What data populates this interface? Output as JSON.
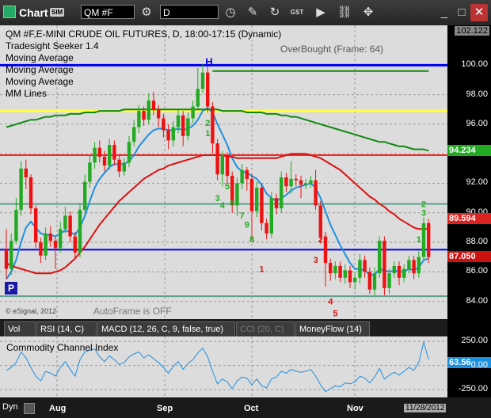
{
  "toolbar": {
    "app_label": "Chart",
    "sim_label": "SIM",
    "symbol": "QM #F",
    "interval": "D",
    "gst_label": "GST"
  },
  "window_controls": {
    "minimize": "_",
    "maximize": "□",
    "close": "✕"
  },
  "chart_header": {
    "line1": "QM #F,E-MINI CRUDE OIL FUTURES, D, 18:00-17:15 (Dynamic)",
    "line2": "Tradesight Seeker 1.4",
    "line3": "Moving Average",
    "line4": "Moving Average",
    "line5": "Moving Average",
    "line6": "MM Lines",
    "overbought": "OverBought (Frame: 64)",
    "copyright": "© eSignal, 2012",
    "autoframe": "AutoFrame is OFF",
    "p_button": "P"
  },
  "cci_panel": {
    "title": "Commodity Channel Index",
    "value_badge": "63.56"
  },
  "tabs": [
    {
      "label": "Vol",
      "active": false
    },
    {
      "label": "RSI (14, C)",
      "active": false
    },
    {
      "label": "MACD (12, 26, C, 9, false, true)",
      "active": false
    },
    {
      "label": "CCI (20, C)",
      "active": true
    },
    {
      "label": "MoneyFlow (14)",
      "active": false
    }
  ],
  "footer": {
    "dyn_label": "Dyn",
    "date_badge": "11/28/2012"
  },
  "colors": {
    "plot_bg": "#dcdcdc",
    "up": "#22aa22",
    "down": "#ee1111",
    "ma_blue": "#1e90e0",
    "ma_red": "#dd1111",
    "ma_green": "#118811",
    "line_blue": "#0000ee",
    "line_yellow": "#ffff44",
    "line_red": "#ff2222",
    "line_teal": "#5f9f8f",
    "badge_price": "#cc1111",
    "badge_green": "#22aa22",
    "badge_red": "#dd2222",
    "badge_blue": "#1e90e0"
  },
  "chart_data": {
    "type": "candlestick",
    "x_ticks": [
      "Aug",
      "Sep",
      "Oct",
      "Nov"
    ],
    "y_ticks": [
      84.0,
      86.0,
      88.0,
      90.0,
      92.0,
      94.0,
      96.0,
      98.0,
      100.0,
      102.122
    ],
    "ylim": [
      82.8,
      102.7
    ],
    "value_badges": [
      {
        "value": "94.234",
        "color": "#22aa22",
        "y": 94.234
      },
      {
        "value": "89.594",
        "color": "#dd2222",
        "y": 89.594
      },
      {
        "value": "87.050",
        "color": "#cc1111",
        "y": 87.05
      }
    ],
    "horizontal_lines": [
      {
        "y": 100.0,
        "color": "#0000ee",
        "width": 3
      },
      {
        "y": 96.9,
        "color": "#ffff44",
        "width": 3
      },
      {
        "y": 93.9,
        "color": "#ff2222",
        "width": 2
      },
      {
        "y": 90.6,
        "color": "#5f9f8f",
        "width": 2
      },
      {
        "y": 87.5,
        "color": "#0000ee",
        "width": 2
      },
      {
        "y": 84.35,
        "color": "#5f9f8f",
        "width": 2
      }
    ],
    "candles": [
      [
        87.5,
        86.2,
        88.9,
        85.5
      ],
      [
        86.2,
        88.1,
        88.6,
        85.8
      ],
      [
        88.1,
        90.2,
        91.0,
        87.9
      ],
      [
        90.2,
        93.0,
        93.5,
        89.8
      ],
      [
        93.0,
        92.4,
        93.6,
        91.6
      ],
      [
        92.4,
        90.3,
        92.6,
        89.9
      ],
      [
        90.3,
        88.0,
        90.5,
        87.6
      ],
      [
        88.0,
        87.1,
        88.3,
        86.6
      ],
      [
        87.1,
        88.6,
        89.0,
        86.8
      ],
      [
        88.6,
        88.1,
        89.1,
        87.7
      ],
      [
        88.1,
        87.6,
        88.4,
        86.2
      ],
      [
        87.6,
        88.9,
        89.4,
        87.3
      ],
      [
        88.9,
        89.8,
        90.4,
        88.6
      ],
      [
        89.8,
        88.4,
        90.1,
        88.0
      ],
      [
        88.4,
        87.3,
        88.7,
        86.9
      ],
      [
        87.3,
        90.2,
        90.6,
        87.0
      ],
      [
        90.2,
        92.1,
        92.6,
        89.9
      ],
      [
        92.1,
        93.4,
        93.9,
        91.7
      ],
      [
        93.4,
        94.4,
        94.8,
        93.0
      ],
      [
        94.4,
        93.8,
        94.9,
        93.4
      ],
      [
        93.8,
        93.2,
        94.2,
        92.8
      ],
      [
        93.2,
        94.6,
        95.0,
        92.9
      ],
      [
        94.6,
        93.6,
        94.9,
        93.2
      ],
      [
        93.6,
        92.8,
        93.9,
        92.4
      ],
      [
        92.8,
        93.4,
        93.7,
        92.5
      ],
      [
        93.4,
        94.8,
        95.2,
        93.1
      ],
      [
        94.8,
        95.8,
        96.3,
        94.5
      ],
      [
        95.8,
        96.9,
        97.3,
        95.4
      ],
      [
        96.9,
        96.3,
        97.2,
        95.9
      ],
      [
        96.3,
        97.6,
        98.1,
        96.0
      ],
      [
        97.6,
        97.0,
        98.2,
        96.6
      ],
      [
        97.0,
        96.4,
        97.3,
        95.8
      ],
      [
        96.4,
        95.6,
        96.7,
        95.1
      ],
      [
        95.6,
        94.9,
        96.0,
        94.3
      ],
      [
        94.9,
        95.8,
        96.2,
        94.5
      ],
      [
        95.8,
        96.6,
        97.0,
        95.4
      ],
      [
        96.6,
        95.2,
        96.9,
        94.5
      ],
      [
        95.2,
        96.4,
        96.8,
        94.9
      ],
      [
        96.4,
        97.2,
        97.6,
        96.1
      ],
      [
        97.2,
        98.4,
        99.8,
        97.0
      ],
      [
        98.4,
        99.5,
        100.1,
        98.1
      ],
      [
        99.5,
        97.2,
        99.9,
        96.8
      ],
      [
        97.2,
        94.7,
        97.5,
        94.0
      ],
      [
        94.7,
        92.6,
        95.0,
        92.2
      ],
      [
        92.6,
        93.9,
        94.2,
        91.8
      ],
      [
        93.9,
        92.5,
        94.1,
        92.0
      ],
      [
        92.5,
        90.5,
        92.8,
        90.0
      ],
      [
        90.5,
        92.0,
        92.4,
        89.8
      ],
      [
        92.0,
        92.9,
        93.3,
        91.6
      ],
      [
        92.9,
        92.3,
        93.1,
        91.5
      ],
      [
        92.3,
        90.1,
        92.6,
        88.2
      ],
      [
        90.1,
        91.7,
        92.1,
        89.7
      ],
      [
        91.7,
        89.3,
        92.0,
        88.8
      ],
      [
        89.3,
        88.6,
        89.6,
        88.2
      ],
      [
        88.6,
        91.0,
        91.4,
        88.3
      ],
      [
        91.0,
        90.3,
        91.3,
        89.9
      ],
      [
        90.3,
        92.4,
        92.8,
        90.0
      ],
      [
        92.4,
        91.8,
        92.7,
        91.4
      ],
      [
        91.8,
        92.3,
        93.5,
        91.3
      ],
      [
        92.3,
        92.2,
        92.6,
        91.8
      ],
      [
        92.2,
        91.9,
        92.5,
        91.0
      ],
      [
        91.9,
        92.0,
        92.3,
        91.6
      ],
      [
        92.0,
        92.2,
        92.5,
        91.7
      ],
      [
        92.2,
        90.5,
        92.9,
        90.2
      ],
      [
        90.5,
        88.4,
        90.8,
        87.9
      ],
      [
        88.4,
        86.6,
        88.7,
        85.0
      ],
      [
        86.6,
        85.9,
        86.9,
        85.4
      ],
      [
        85.9,
        86.4,
        86.7,
        85.5
      ],
      [
        86.4,
        85.6,
        86.7,
        85.3
      ],
      [
        85.6,
        86.1,
        86.5,
        85.2
      ],
      [
        86.1,
        85.3,
        86.4,
        84.9
      ],
      [
        85.3,
        85.6,
        86.0,
        84.8
      ],
      [
        85.6,
        86.8,
        87.2,
        85.2
      ],
      [
        86.8,
        86.0,
        87.1,
        85.6
      ],
      [
        86.0,
        84.8,
        86.3,
        84.5
      ],
      [
        84.8,
        85.9,
        86.3,
        84.4
      ],
      [
        85.9,
        88.1,
        88.4,
        85.6
      ],
      [
        88.1,
        84.9,
        88.4,
        84.4
      ],
      [
        84.9,
        85.9,
        86.2,
        84.5
      ],
      [
        85.9,
        86.4,
        86.7,
        85.6
      ],
      [
        86.4,
        85.6,
        86.7,
        85.1
      ],
      [
        85.6,
        86.2,
        86.5,
        85.3
      ],
      [
        86.2,
        86.8,
        87.1,
        85.9
      ],
      [
        86.8,
        85.9,
        87.1,
        85.5
      ],
      [
        85.9,
        87.0,
        87.4,
        85.6
      ],
      [
        87.0,
        89.3,
        89.7,
        86.8
      ],
      [
        89.3,
        87.0,
        89.6,
        86.6
      ]
    ],
    "moving_averages": [
      {
        "name": "",
        "color": "#1e90e0",
        "values": [
          85.5,
          86.0,
          86.8,
          88.0,
          89.0,
          89.4,
          89.0,
          88.6,
          88.5,
          88.5,
          88.4,
          88.6,
          88.8,
          88.7,
          88.5,
          89.0,
          89.8,
          90.8,
          91.7,
          92.3,
          92.7,
          93.1,
          93.3,
          93.3,
          93.3,
          93.5,
          93.9,
          94.5,
          94.9,
          95.3,
          95.6,
          95.7,
          95.7,
          95.6,
          95.6,
          95.7,
          95.6,
          95.7,
          95.9,
          96.3,
          96.9,
          97.1,
          96.8,
          96.0,
          95.3,
          94.6,
          93.7,
          93.1,
          92.8,
          92.7,
          92.5,
          92.3,
          91.9,
          91.3,
          91.0,
          90.8,
          91.0,
          91.2,
          91.5,
          91.7,
          91.8,
          91.9,
          92.0,
          91.7,
          91.0,
          90.1,
          89.2,
          88.5,
          87.8,
          87.2,
          86.6,
          86.2,
          86.2,
          86.1,
          85.8,
          85.8,
          86.2,
          86.1,
          86.0,
          86.1,
          86.0,
          86.0,
          86.2,
          86.1,
          86.3,
          86.8,
          86.9
        ]
      },
      {
        "name": "",
        "color": "#dd1111",
        "values": [
          86.6,
          86.4,
          86.3,
          86.2,
          86.1,
          86.0,
          85.9,
          85.9,
          85.9,
          85.9,
          86.0,
          86.1,
          86.3,
          86.6,
          86.9,
          87.3,
          87.7,
          88.2,
          88.7,
          89.2,
          89.6,
          90.0,
          90.4,
          90.8,
          91.1,
          91.4,
          91.7,
          92.0,
          92.3,
          92.5,
          92.7,
          92.9,
          93.0,
          93.2,
          93.3,
          93.4,
          93.5,
          93.6,
          93.7,
          93.8,
          93.9,
          93.9,
          93.9,
          93.9,
          93.9,
          93.8,
          93.8,
          93.7,
          93.7,
          93.7,
          93.7,
          93.7,
          93.7,
          93.7,
          93.7,
          93.7,
          93.8,
          93.9,
          94.0,
          94.0,
          94.0,
          94.0,
          93.9,
          93.8,
          93.7,
          93.5,
          93.3,
          93.1,
          92.9,
          92.6,
          92.3,
          92.0,
          91.7,
          91.4,
          91.1,
          90.9,
          90.6,
          90.4,
          90.1,
          89.9,
          89.6,
          89.4,
          89.2,
          89.0,
          88.9,
          88.9,
          88.9
        ]
      },
      {
        "name": "",
        "color": "#118811",
        "values": [
          95.8,
          95.9,
          96.0,
          96.1,
          96.2,
          96.3,
          96.3,
          96.4,
          96.5,
          96.5,
          96.6,
          96.6,
          96.6,
          96.7,
          96.7,
          96.7,
          96.8,
          96.8,
          96.8,
          96.9,
          96.9,
          96.9,
          96.9,
          96.9,
          97.0,
          97.0,
          97.0,
          97.0,
          97.0,
          97.0,
          97.0,
          97.0,
          97.0,
          97.0,
          97.0,
          97.0,
          97.0,
          97.0,
          97.0,
          97.0,
          97.0,
          97.0,
          97.0,
          97.0,
          96.9,
          96.9,
          96.9,
          96.9,
          96.9,
          96.8,
          96.8,
          96.8,
          96.8,
          96.7,
          96.7,
          96.7,
          96.6,
          96.6,
          96.5,
          96.5,
          96.4,
          96.3,
          96.2,
          96.1,
          96.0,
          95.9,
          95.8,
          95.7,
          95.6,
          95.5,
          95.4,
          95.3,
          95.2,
          95.1,
          95.0,
          94.9,
          94.8,
          94.8,
          94.7,
          94.6,
          94.5,
          94.5,
          94.4,
          94.3,
          94.3,
          94.3,
          94.2
        ]
      }
    ],
    "counts": [
      {
        "i": 41,
        "y": 95.2,
        "text": "1",
        "color": "#22aa22"
      },
      {
        "i": 41,
        "y": 95.9,
        "text": "2",
        "color": "#22aa22"
      },
      {
        "i": 41,
        "y": 100.0,
        "text": "H",
        "color": "#0000ee"
      },
      {
        "i": 43,
        "y": 90.8,
        "text": "3",
        "color": "#22aa22"
      },
      {
        "i": 44,
        "y": 90.3,
        "text": "4",
        "color": "#22aa22"
      },
      {
        "i": 45,
        "y": 91.6,
        "text": "5",
        "color": "#22aa22"
      },
      {
        "i": 46,
        "y": 90.5,
        "text": "6",
        "color": "#22aa22"
      },
      {
        "i": 48,
        "y": 89.6,
        "text": "7",
        "color": "#22aa22"
      },
      {
        "i": 50,
        "y": 88.0,
        "text": "8",
        "color": "#22aa22"
      },
      {
        "i": 49,
        "y": 89.0,
        "text": "9",
        "color": "#22aa22"
      },
      {
        "i": 52,
        "y": 86.0,
        "text": "1",
        "color": "#dd1111"
      },
      {
        "i": 64,
        "y": 88.0,
        "text": "2",
        "color": "#dd1111"
      },
      {
        "i": 63,
        "y": 86.6,
        "text": "3",
        "color": "#dd1111"
      },
      {
        "i": 66,
        "y": 83.8,
        "text": "4",
        "color": "#dd1111"
      },
      {
        "i": 67,
        "y": 83.0,
        "text": "5",
        "color": "#dd1111"
      },
      {
        "i": 84,
        "y": 88.0,
        "text": "1",
        "color": "#22aa22"
      },
      {
        "i": 85,
        "y": 90.4,
        "text": "2",
        "color": "#22aa22"
      },
      {
        "i": 85,
        "y": 89.8,
        "text": "3",
        "color": "#22aa22"
      }
    ],
    "overbought_line": {
      "from": 42,
      "to": 86,
      "y": 99.6,
      "color": "#118811"
    },
    "cci": {
      "y_ticks": [
        250.0,
        0.0,
        -250.0
      ],
      "ylim": [
        -330,
        300
      ],
      "values": [
        -50,
        -20,
        30,
        140,
        80,
        -20,
        -110,
        -160,
        -60,
        -80,
        -110,
        -20,
        40,
        -40,
        -110,
        60,
        140,
        160,
        170,
        90,
        40,
        100,
        60,
        10,
        30,
        90,
        120,
        140,
        80,
        110,
        70,
        30,
        -20,
        -80,
        -10,
        40,
        -40,
        20,
        60,
        130,
        180,
        90,
        -60,
        -190,
        -140,
        -170,
        -240,
        -160,
        -120,
        -130,
        -200,
        -140,
        -210,
        -230,
        -140,
        -120,
        -60,
        -80,
        -40,
        -60,
        -70,
        -60,
        -40,
        -110,
        -200,
        -270,
        -240,
        -210,
        -220,
        -180,
        -190,
        -170,
        -110,
        -130,
        -180,
        -120,
        -30,
        -140,
        -100,
        -70,
        -100,
        -60,
        -20,
        -50,
        30,
        240,
        63.56
      ]
    }
  }
}
